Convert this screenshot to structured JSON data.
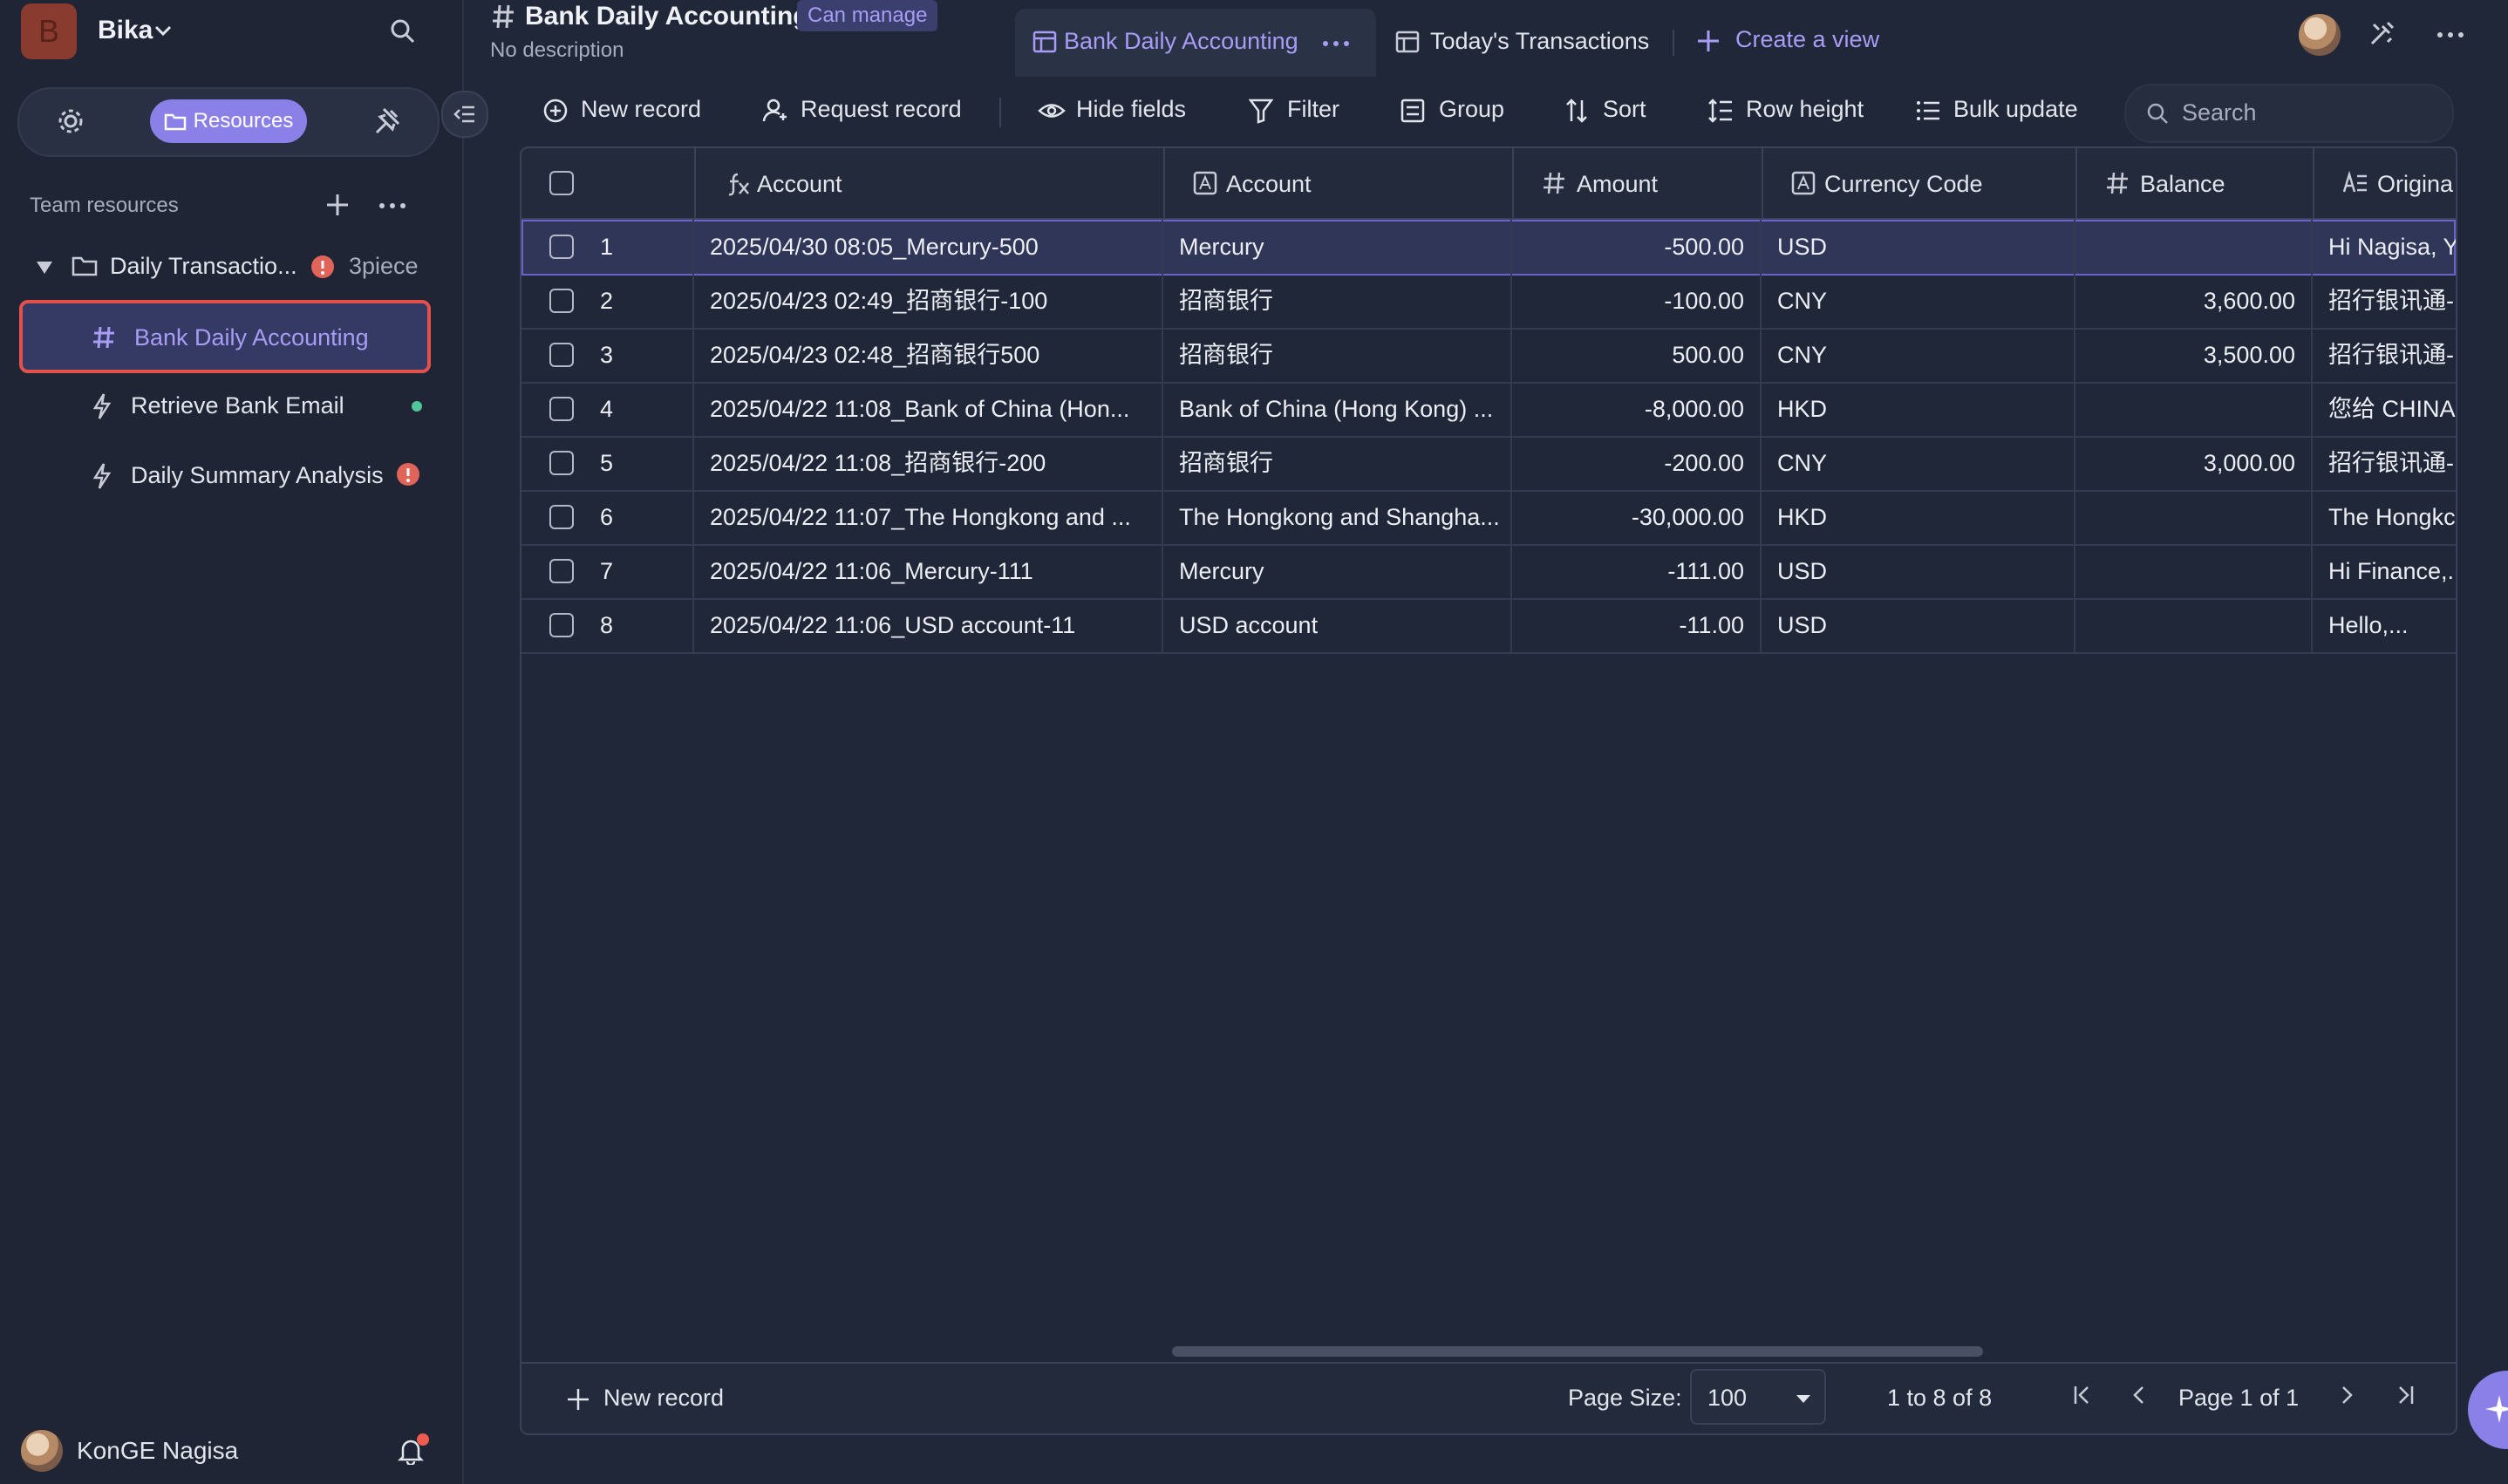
{
  "workspace": {
    "initial": "B",
    "name": "Bika"
  },
  "sidebar": {
    "tabs": {
      "active_label": "Resources"
    },
    "section_label": "Team resources",
    "folder": {
      "name": "Daily Transactio...",
      "count": "3piece"
    },
    "items": [
      {
        "label": "Bank Daily Accounting",
        "icon": "hash-icon",
        "active": true
      },
      {
        "label": "Retrieve Bank Email",
        "icon": "bolt-icon",
        "status": "green-dot"
      },
      {
        "label": "Daily Summary Analysis",
        "icon": "bolt-icon",
        "status": "alert"
      }
    ],
    "user": {
      "name": "KonGE Nagisa"
    }
  },
  "header": {
    "title": "Bank Daily Accounting",
    "badge": "Can manage",
    "description": "No description",
    "views": [
      {
        "label": "Bank Daily Accounting",
        "active": true
      },
      {
        "label": "Today's Transactions",
        "active": false
      }
    ],
    "create_view": "Create a view"
  },
  "toolbar": {
    "new_record": "New record",
    "request_record": "Request record",
    "hide_fields": "Hide fields",
    "filter": "Filter",
    "group": "Group",
    "sort": "Sort",
    "row_height": "Row height",
    "bulk_update": "Bulk update",
    "search_placeholder": "Search"
  },
  "table": {
    "columns": [
      {
        "label": "Account",
        "icon": "formula-icon"
      },
      {
        "label": "Account",
        "icon": "text-field-icon"
      },
      {
        "label": "Amount",
        "icon": "number-icon"
      },
      {
        "label": "Currency Code",
        "icon": "text-field-icon"
      },
      {
        "label": "Balance",
        "icon": "number-icon"
      },
      {
        "label": "Origina",
        "icon": "long-text-icon"
      }
    ],
    "rows": [
      {
        "n": "1",
        "name": "2025/04/30 08:05_Mercury-500",
        "account": "Mercury",
        "amount": "-500.00",
        "currency": "USD",
        "balance": "",
        "original": "Hi Nagisa, Y"
      },
      {
        "n": "2",
        "name": "2025/04/23 02:49_招商银行-100",
        "account": "招商银行",
        "amount": "-100.00",
        "currency": "CNY",
        "balance": "3,600.00",
        "original": "招行银讯通-"
      },
      {
        "n": "3",
        "name": "2025/04/23 02:48_招商银行500",
        "account": "招商银行",
        "amount": "500.00",
        "currency": "CNY",
        "balance": "3,500.00",
        "original": "招行银讯通-"
      },
      {
        "n": "4",
        "name": "2025/04/22 11:08_Bank of China (Hon...",
        "account": "Bank of China (Hong Kong) ...",
        "amount": "-8,000.00",
        "currency": "HKD",
        "balance": "",
        "original": "您给 CHINA"
      },
      {
        "n": "5",
        "name": "2025/04/22 11:08_招商银行-200",
        "account": "招商银行",
        "amount": "-200.00",
        "currency": "CNY",
        "balance": "3,000.00",
        "original": "招行银讯通-"
      },
      {
        "n": "6",
        "name": "2025/04/22 11:07_The Hongkong and ...",
        "account": "The Hongkong and Shangha...",
        "amount": "-30,000.00",
        "currency": "HKD",
        "balance": "",
        "original": "The Hongkc"
      },
      {
        "n": "7",
        "name": "2025/04/22 11:06_Mercury-111",
        "account": "Mercury",
        "amount": "-111.00",
        "currency": "USD",
        "balance": "",
        "original": "Hi Finance,..."
      },
      {
        "n": "8",
        "name": "2025/04/22 11:06_USD account-11",
        "account": "USD account",
        "amount": "-11.00",
        "currency": "USD",
        "balance": "",
        "original": "Hello,..."
      }
    ]
  },
  "footer": {
    "new_record": "New record",
    "page_size_label": "Page Size:",
    "page_size": "100",
    "range": "1 to 8 of 8",
    "page_text": "Page 1 of 1"
  },
  "colors": {
    "accent": "#8b80e8",
    "active_border": "#e3514d",
    "background": "#202738"
  }
}
